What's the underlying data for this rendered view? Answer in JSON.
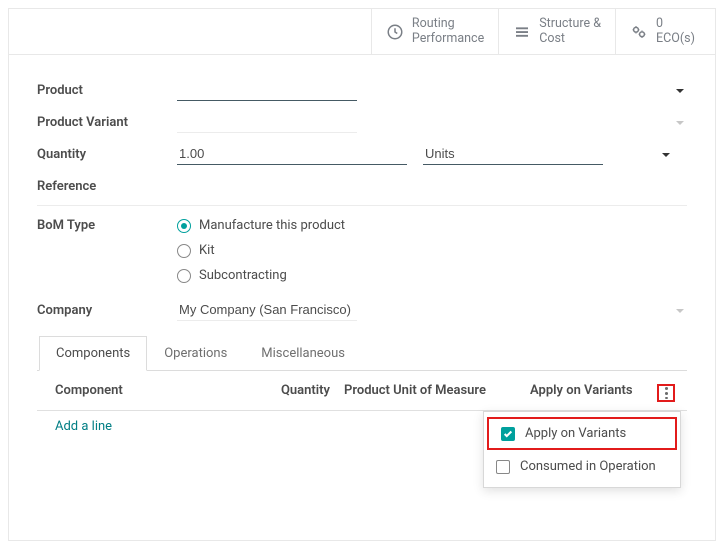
{
  "stat_buttons": {
    "routing": {
      "line1": "Routing",
      "line2": "Performance"
    },
    "structure": {
      "line1": "Structure &",
      "line2": "Cost"
    },
    "ecos": {
      "line1": "0",
      "line2": "ECO(s)"
    }
  },
  "form": {
    "product_label": "Product",
    "product_value": "",
    "variant_label": "Product Variant",
    "variant_value": "",
    "quantity_label": "Quantity",
    "quantity_value": "1.00",
    "uom_value": "Units",
    "reference_label": "Reference",
    "reference_value": "",
    "bom_type_label": "BoM Type",
    "bom_type_options": {
      "manufacture": "Manufacture this product",
      "kit": "Kit",
      "subcontract": "Subcontracting"
    },
    "bom_type_selected": "manufacture",
    "company_label": "Company",
    "company_value": "My Company (San Francisco)"
  },
  "tabs": {
    "components": "Components",
    "operations": "Operations",
    "misc": "Miscellaneous",
    "active": "components"
  },
  "table": {
    "headers": {
      "component": "Component",
      "quantity": "Quantity",
      "uom": "Product Unit of Measure",
      "variants": "Apply on Variants"
    },
    "add_line": "Add a line"
  },
  "column_menu": {
    "apply_variants": {
      "label": "Apply on Variants",
      "checked": true
    },
    "consumed_op": {
      "label": "Consumed in Operation",
      "checked": false
    }
  }
}
